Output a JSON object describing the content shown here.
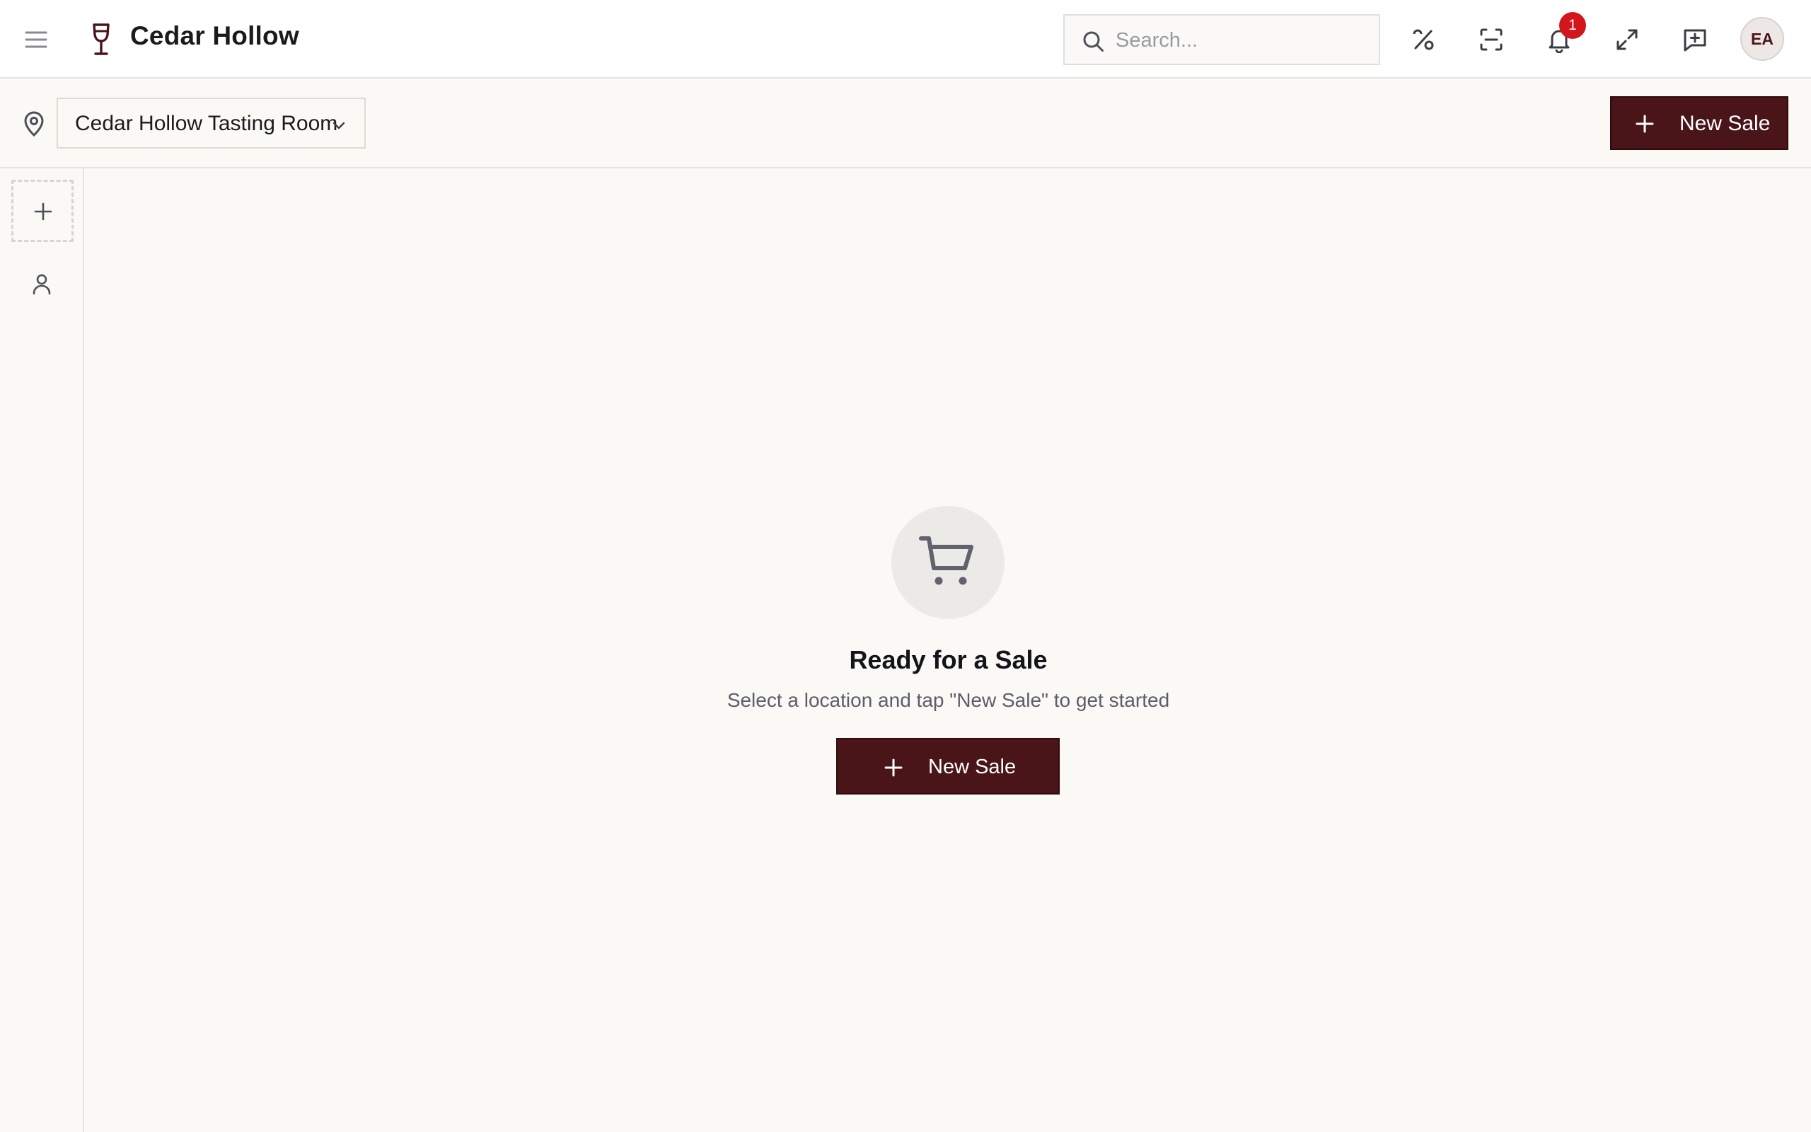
{
  "header": {
    "app_title": "Cedar Hollow",
    "search_placeholder": "Search...",
    "notification_count": "1",
    "user_initials": "EA",
    "icons": [
      "menu-icon",
      "wine-glass-icon",
      "search-icon",
      "discount-icon",
      "scan-icon",
      "bell-icon",
      "expand-icon",
      "message-plus-icon"
    ]
  },
  "subbar": {
    "location": "Cedar Hollow Tasting Room",
    "new_sale_label": "New Sale"
  },
  "main": {
    "empty_title": "Ready for a Sale",
    "empty_subtitle": "Select a location and tap \"New Sale\" to get started",
    "new_sale_label": "New Sale"
  },
  "colors": {
    "brand": "#4a1518",
    "badge": "#d3161c",
    "background": "#faf9f6"
  }
}
